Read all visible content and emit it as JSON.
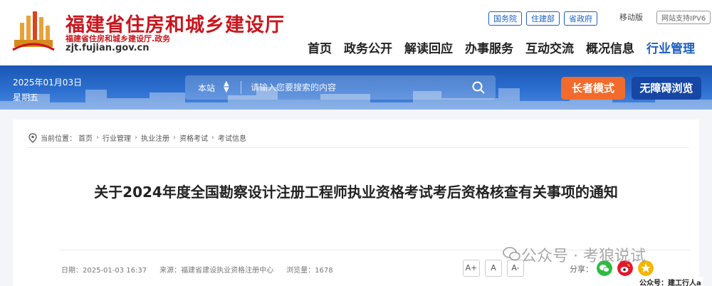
{
  "header": {
    "site_title": "福建省住房和城乡建设厅",
    "site_sub": "福建省住房和城乡建设厅.政务",
    "site_domain": "zjt.fujian.gov.cn",
    "top_links": [
      "国务院",
      "住建部",
      "省政府"
    ],
    "mobile": "移动版",
    "ipv6": "网站支持IPV6",
    "nav": [
      "首页",
      "政务公开",
      "解读回应",
      "办事服务",
      "互动交流",
      "概况信息",
      "行业管理"
    ],
    "nav_active": "行业管理"
  },
  "banner": {
    "date": "2025年01月03日",
    "weekday": "星期五",
    "search_scope": "本站",
    "search_placeholder": "请输入您要搜索的内容",
    "elder_mode": "长者模式",
    "accessible": "无障碍浏览"
  },
  "breadcrumb": {
    "prefix": "当前位置：",
    "items": [
      "首页",
      "行业管理",
      "执业注册",
      "资格考试",
      "考试信息"
    ]
  },
  "article": {
    "title": "关于2024年度全国勘察设计注册工程师执业资格考试考后资格核查有关事项的通知",
    "date_label": "日期：2025-01-03 16:37",
    "source_label": "来源：福建省建设执业资格注册中心",
    "views_label": "浏览量：1678"
  },
  "tools": {
    "font_buttons": [
      "A+",
      "A",
      "A-"
    ],
    "share_label": "分享："
  },
  "watermark": {
    "text": "公众号 · 考狼说试",
    "caption": "公众号：建工行人a"
  },
  "colors": {
    "brand_red": "#c8161d",
    "nav_blue": "#1d5fbf",
    "elder_orange": "#f26b2c",
    "accessible_blue": "#1747a4"
  }
}
